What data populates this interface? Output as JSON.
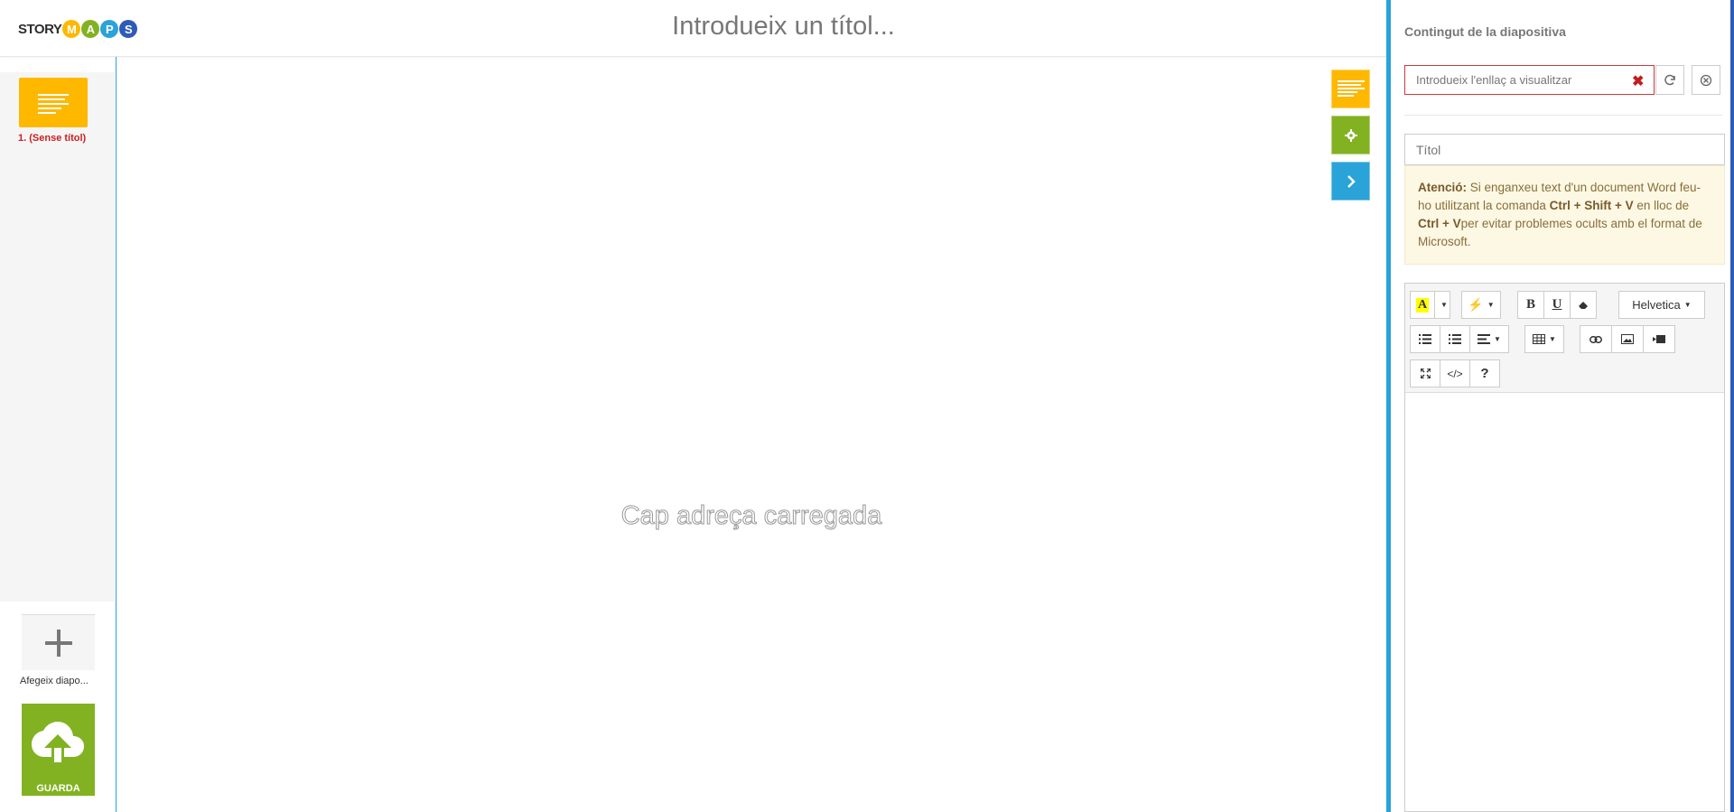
{
  "header": {
    "logo": {
      "word": "STORY",
      "letters": [
        "M",
        "A",
        "P",
        "S"
      ],
      "colors": [
        "#ffb800",
        "#82b222",
        "#2aa3d8",
        "#2d5bb7"
      ]
    },
    "title_placeholder": "Introdueix un títol..."
  },
  "sidebar": {
    "slides": [
      {
        "number": "1.",
        "label": "(Sense títol)"
      }
    ],
    "add_slide_label": "Afegeix diapo...",
    "save_label": "GUARDA"
  },
  "main": {
    "empty_message": "Cap adreça carregada",
    "float_buttons": [
      {
        "icon": "lines-icon",
        "color": "#ffb800"
      },
      {
        "icon": "gear-icon",
        "color": "#82b222"
      },
      {
        "icon": "chevron-right-icon",
        "color": "#2aa3d8"
      }
    ]
  },
  "panel": {
    "title": "Contingut de la diapositiva",
    "url_placeholder": "Introdueix l'enllaç a visualitzar",
    "title_placeholder": "Títol",
    "warning": {
      "heading": "Atenció:",
      "text1": " Si enganxeu text d'un document Word feu-ho utilitzant la comanda ",
      "shortcut1": "Ctrl + Shift + V",
      "text2": " en lloc de ",
      "shortcut2": "Ctrl + V",
      "text3": "per evitar problemes ocults amb el format de Microsoft."
    },
    "toolbar": {
      "font_name": "Helvetica",
      "bold": "B",
      "underline": "U",
      "code": "</>",
      "help": "?"
    }
  }
}
